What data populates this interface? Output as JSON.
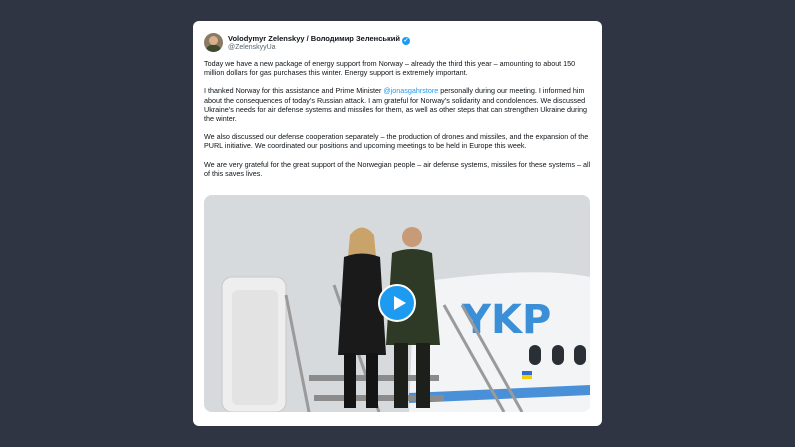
{
  "tweet": {
    "author_name": "Volodymyr Zelenskyy / Володимир Зеленський",
    "author_handle": "@ZelenskyyUa",
    "verified_mark": "✓",
    "paragraph_1": "Today we have a new package of energy support from Norway – already the third this year – amounting to about 150 million dollars for gas purchases this winter. Energy support is extremely important.",
    "paragraph_2_before": "I thanked Norway for this assistance and Prime Minister ",
    "paragraph_2_mention": "@jonasgahrstore",
    "paragraph_2_after": " personally during our meeting. I informed him about the consequences of today’s Russian attack. I am grateful for Norway’s solidarity and condolences. We discussed Ukraine’s needs for air defense systems and missiles for them, as well as other steps that can strengthen Ukraine during the winter.",
    "paragraph_3": "We also discussed our defense cooperation separately – the production of drones and missiles, and the expansion of the PURL initiative. We coordinated our positions and upcoming meetings to be held in Europe this week.",
    "paragraph_4": "We are very grateful for the great support of the Norwegian people – air defense systems, missiles for these systems – all of this saves lives.",
    "plane_livery_text": "YKP"
  },
  "icons": {
    "play": "play-icon",
    "verified": "verified-badge-icon"
  },
  "colors": {
    "background": "#2f3542",
    "link": "#1d9bf0",
    "card": "#ffffff"
  }
}
